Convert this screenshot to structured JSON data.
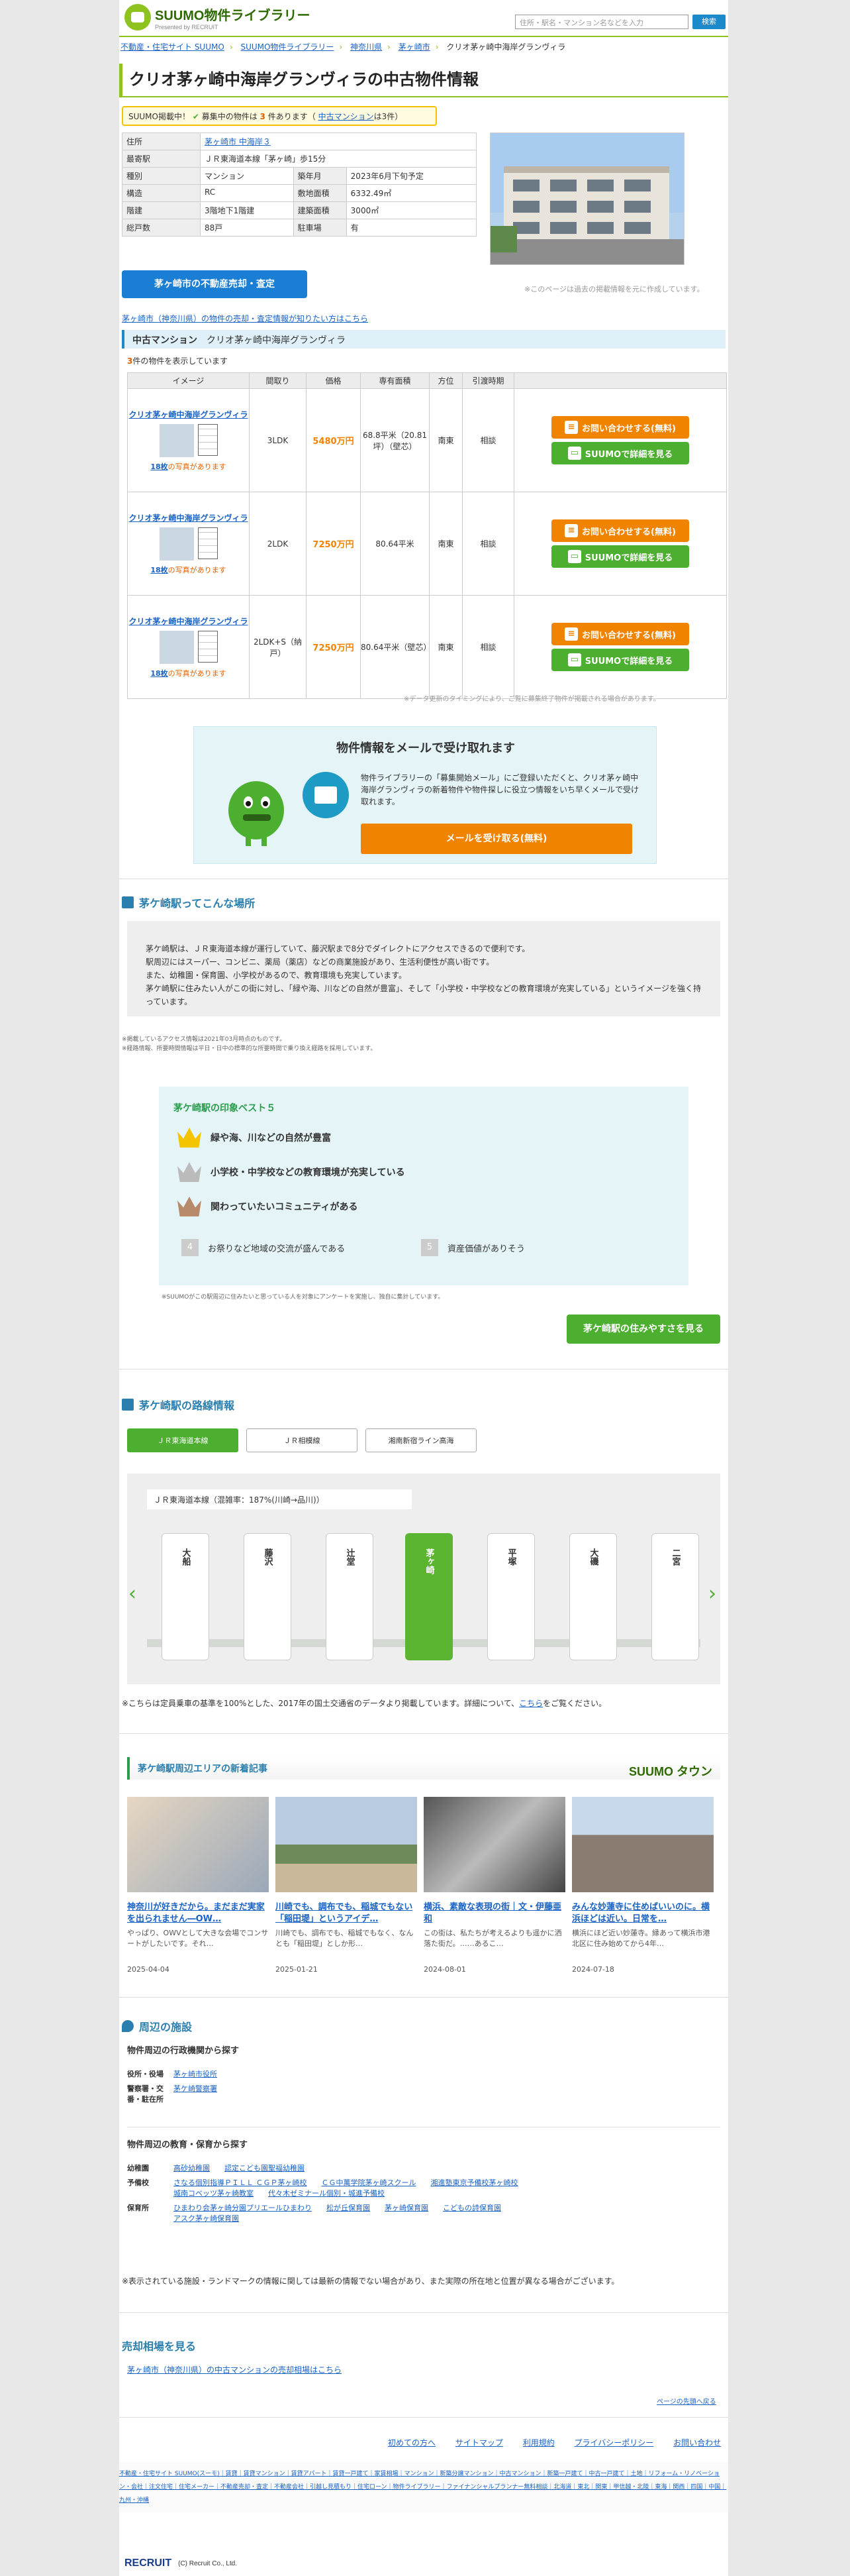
{
  "header": {
    "logo": "SUUMO",
    "logo_sub": "物件ライブラリー",
    "logo_by": "Presented by RECRUIT",
    "search_placeholder": "住所・駅名・マンション名などを入力",
    "search_button": "検索"
  },
  "breadcrumb": [
    "不動産・住宅サイト SUUMO",
    "SUUMO物件ライブラリー",
    "神奈川県",
    "茅ヶ崎市",
    "クリオ茅ヶ崎中海岸グランヴィラ"
  ],
  "title": "クリオ茅ヶ崎中海岸グランヴィラの中古物件情報",
  "notice": {
    "lead": "SUUMO掲載中！",
    "mid": "募集中の物件は",
    "count": "3",
    "unit": "件あります（",
    "link": "中古マンション",
    "link_count": "は3件）"
  },
  "info": {
    "rows": [
      {
        "k1": "住所",
        "v1": "茅ヶ崎市 中海岸３",
        "k2": "",
        "v2": ""
      },
      {
        "k1": "最寄駅",
        "v1": "ＪＲ東海道本線「茅ヶ崎」歩15分",
        "k2": "",
        "v2": ""
      },
      {
        "k1": "種別",
        "v1": "マンション",
        "k2": "築年月",
        "v2": "2023年6月下旬予定"
      },
      {
        "k1": "構造",
        "v1": "RC",
        "k2": "敷地面積",
        "v2": "6332.49㎡"
      },
      {
        "k1": "階建",
        "v1": "3階地下1階建",
        "k2": "建築面積",
        "v2": "3000㎡"
      },
      {
        "k1": "総戸数",
        "v1": "88戸",
        "k2": "駐車場",
        "v2": "有"
      }
    ]
  },
  "photo_note": "※このページは過去の掲載情報を元に作成しています。",
  "sell_button": "茅ヶ崎市の不動産売却・査定",
  "sell_link": "茅ヶ崎市（神奈川県）の物件の売却・査定情報が知りたい方はこちら",
  "listing": {
    "bar_label": "中古マンション",
    "bar_name": "クリオ茅ヶ崎中海岸グランヴィラ",
    "count": "3",
    "count_suffix": "件の物件を表示しています",
    "headers": [
      "イメージ",
      "間取り",
      "価格",
      "専有面積",
      "方位",
      "引渡時期",
      ""
    ],
    "rows": [
      {
        "name": "クリオ茅ヶ崎中海岸グランヴィラ",
        "photos": "18枚",
        "photos_suffix": "の写真があります",
        "layout": "3LDK",
        "price": "5480万円",
        "area": "68.8平米（20.81坪）（壁芯）",
        "dir": "南東",
        "delivery": "相談"
      },
      {
        "name": "クリオ茅ヶ崎中海岸グランヴィラ",
        "photos": "18枚",
        "photos_suffix": "の写真があります",
        "layout": "2LDK",
        "price": "7250万円",
        "area": "80.64平米",
        "dir": "南東",
        "delivery": "相談"
      },
      {
        "name": "クリオ茅ヶ崎中海岸グランヴィラ",
        "photos": "18枚",
        "photos_suffix": "の写真があります",
        "layout": "2LDK+S（納戸）",
        "price": "7250万円",
        "area": "80.64平米（壁芯）",
        "dir": "南東",
        "delivery": "相談"
      }
    ],
    "btn_inquiry": "お問い合わせする(無料)",
    "btn_detail": "SUUMOで詳細を見る",
    "note": "※データ更新のタイミングにより、ご覧に募集終了物件が掲載される場合があります。"
  },
  "mail": {
    "title": "物件情報をメールで受け取れます",
    "text": "物件ライブラリーの「募集開始メール」にご登録いただくと、クリオ茅ヶ崎中海岸グランヴィラの新着物件や物件探しに役立つ情報をいち早くメールで受け取れます。",
    "button": "メールを受け取る(無料)"
  },
  "area": {
    "heading": "茅ケ崎駅ってこんな場所",
    "lines": [
      "茅ケ崎駅は、ＪＲ東海道本線が運行していて、藤沢駅まで8分でダイレクトにアクセスできるので便利です。",
      "駅周辺にはスーパー、コンビニ、薬局（薬店）などの商業施設があり、生活利便性が高い街です。",
      "また、幼稚園・保育園、小学校があるので、教育環境も充実しています。",
      "茅ケ崎駅に住みたい人がこの街に対し、「緑や海、川などの自然が豊富」、そして「小学校・中学校などの教育環境が充実している」というイメージを強く持っています。"
    ],
    "notes": [
      "※掲載しているアクセス情報は2021年03月時点のものです。",
      "※経路情報、所要時間情報は平日・日中の標準的な所要時間で乗り換え経路を採用しています。"
    ],
    "best_title": "茅ケ崎駅の印象ベスト５",
    "best": [
      "緑や海、川などの自然が豊富",
      "小学校・中学校などの教育環境が充実している",
      "関わっていたいコミュニティがある",
      "お祭りなど地域の交流が盛んである",
      "資産価値がありそう"
    ],
    "best_note": "※SUUMOがこの駅周辺に住みたいと思っている人を対象にアンケートを実施し、独自に集計しています。",
    "button": "茅ケ崎駅の住みやすさを見る"
  },
  "route": {
    "heading": "茅ケ崎駅の路線情報",
    "tabs": [
      "ＪＲ東海道本線",
      "ＪＲ相模線",
      "湘南新宿ライン高海"
    ],
    "line_label": "ＪＲ東海道本線（混雑率：187%(川崎→品川)）",
    "stations": [
      "大船",
      "藤沢",
      "辻堂",
      "茅ヶ崎",
      "平塚",
      "大磯",
      "二宮"
    ],
    "note_pre": "※こちらは定員乗車の基準を100%とした、2017年の国土交通省のデータより掲載しています。詳細について、",
    "note_link": "こちら",
    "note_post": "をご覧ください。"
  },
  "articles": {
    "heading": "茅ケ崎駅周辺エリアの新着記事",
    "brand": "SUUMO タウン",
    "items": [
      {
        "title": "神奈川が好きだから。まだまだ実家を出られません―OW…",
        "desc": "やっぱり、OWVとして大きな会場でコンサートがしたいです。それ…",
        "date": "2025-04-04"
      },
      {
        "title": "川崎でも、調布でも、稲城でもない「稲田堤」というアイデ…",
        "desc": "川崎でも、調布でも、稲城でもなく、なんとも「稲田堤」としか形…",
        "date": "2025-01-21"
      },
      {
        "title": "横浜、素敵な表現の街｜文・伊藤亜和",
        "desc": "この街は、私たちが考えるよりも遥かに洒落た街だ。……あるこ…",
        "date": "2024-08-01"
      },
      {
        "title": "みんな妙蓮寺に住めばいいのに。横浜ほどは近い。日常を…",
        "desc": "横浜にほど近い妙蓮寺。縁あって横浜市港北区に住み始めてから4年…",
        "date": "2024-07-18"
      }
    ]
  },
  "facilities": {
    "heading": "周辺の施設",
    "admin_title": "物件周辺の行政機関から探す",
    "admin": [
      {
        "label": "役所・役場",
        "items": [
          "茅ヶ崎市役所"
        ]
      },
      {
        "label": "警察署・交番・駐在所",
        "items": [
          "茅ケ崎警察署"
        ]
      }
    ],
    "edu_title": "物件周辺の教育・保育から探す",
    "edu": [
      {
        "label": "幼稚園",
        "items": [
          "高砂幼稚園",
          "認定こども園聖福幼稚園"
        ]
      },
      {
        "label": "予備校",
        "items": [
          "さなる個別指導ＰＩＬＬ ＣＧＰ茅ヶ崎校",
          "ＣＧ中萬学院茅ヶ崎スクール",
          "湘進塾東京予備校茅ヶ崎校",
          "城南コベッツ茅ヶ崎教室",
          "代々木ゼミナール個別・城進予備校"
        ]
      },
      {
        "label": "保育所",
        "items": [
          "ひまわり会茅ヶ崎分園プリエールひまわり",
          "松が丘保育園",
          "茅ヶ崎保育園",
          "こどもの詩保育園",
          "アスク茅ヶ崎保育園"
        ]
      }
    ],
    "disclaimer": "※表示されている施設・ランドマークの情報に関しては最新の情報でない場合があり、また実際の所在地と位置が異なる場合がございます。"
  },
  "market": {
    "title": "売却相場を見る",
    "link": "茅ヶ崎市（神奈川県）の中古マンションの売却相場はこちら"
  },
  "totop": "ページの先頭へ戻る",
  "footer": {
    "links": [
      "初めての方へ",
      "サイトマップ",
      "利用規約",
      "プライバシーポリシー",
      "お問い合わせ"
    ],
    "list": "不動産・住宅サイト SUUMO(スーモ)｜賃貸｜賃貸マンション｜賃貸アパート｜賃貸一戸建て｜家賃相場｜マンション｜新築分譲マンション｜中古マンション｜新築一戸建て｜中古一戸建て｜土地｜リフォーム・リノベーション・会社｜注文住宅｜住宅メーカー｜不動産売却・査定｜不動産会社｜引越し見積もり｜住宅ローン｜物件ライブラリー｜ファイナンシャルプランナー無料相談｜北海道｜東北｜関東｜甲信越・北陸｜東海｜関西｜四国｜中国｜九州・沖縄",
    "company": "RECRUIT",
    "copy": "(C) Recruit Co., Ltd."
  },
  "colors": {
    "green": "#8dc21f",
    "orange": "#f08300",
    "blue": "#1a7fd4"
  }
}
